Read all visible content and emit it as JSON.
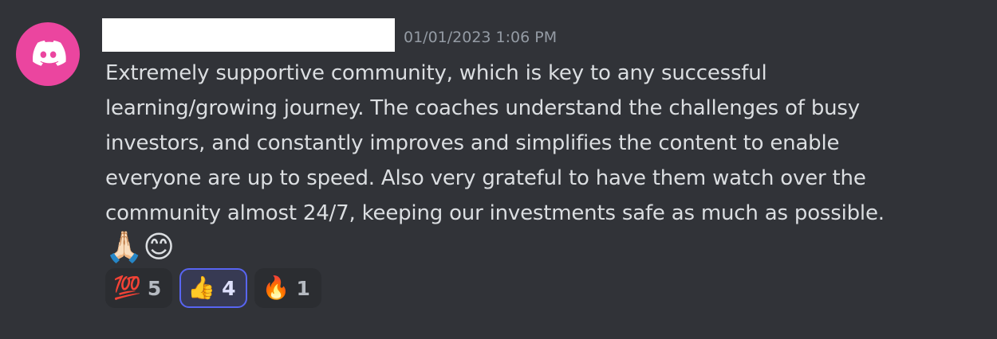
{
  "message": {
    "timestamp": "01/01/2023 1:06 PM",
    "content_lines": [
      "Extremely supportive community, which is key to any successful",
      "learning/growing journey. The coaches understand the challenges of busy",
      "investors, and constantly improves and simplifies the content to enable",
      "everyone are up to speed. Also very grateful to have them watch over the",
      "community almost 24/7, keeping our investments safe as much as possible."
    ],
    "trailing_emojis": "🙏🏻😊"
  },
  "reactions": [
    {
      "emoji": "💯",
      "count": "5",
      "active": false
    },
    {
      "emoji": "👍",
      "count": "4",
      "active": true
    },
    {
      "emoji": "🔥",
      "count": "1",
      "active": false
    }
  ],
  "colors": {
    "background": "#313338",
    "avatar": "#eb459f",
    "text": "#dbdee1",
    "timestamp": "#949ba4",
    "reaction_bg": "#2b2d31",
    "reaction_active_border": "#5865f2"
  },
  "icons": {
    "avatar": "discord-logo-icon"
  }
}
